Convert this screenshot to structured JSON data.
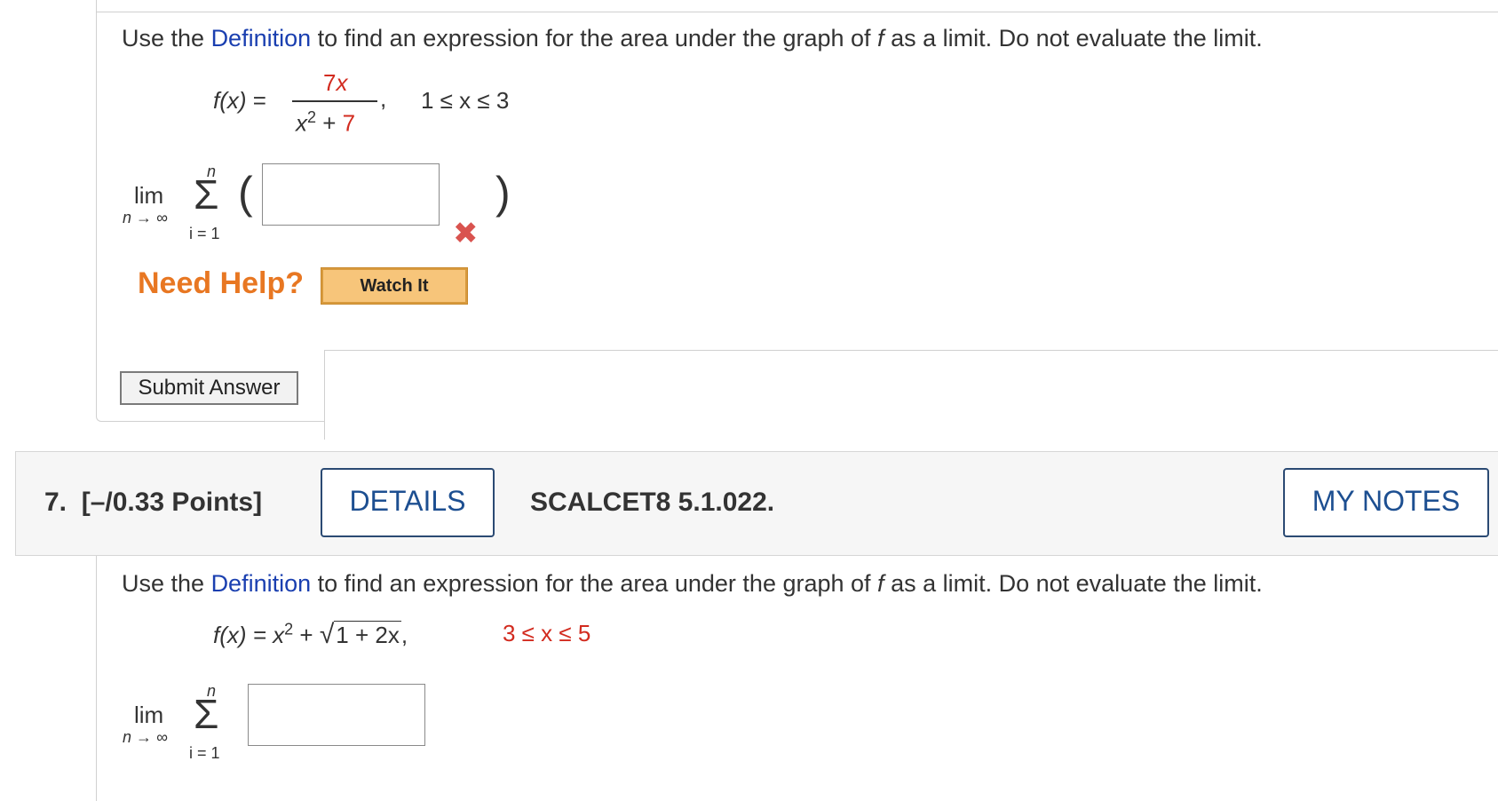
{
  "q6": {
    "prompt": {
      "before_link": "Use the ",
      "link": "Definition",
      "after_link": " to find an expression for the area under the graph of ",
      "f": "f",
      "end": " as a limit. Do not evaluate the limit."
    },
    "function": {
      "lhs": "f(x)",
      "eq": "=",
      "num_coef": "7",
      "num_var": "x",
      "den_base": "x",
      "den_exp": "2",
      "den_plus": " + ",
      "den_const": "7",
      "comma": ",",
      "domain": "1 ≤ x ≤ 3"
    },
    "limit": {
      "lim": "lim",
      "sub": "n → ∞",
      "upper": "n",
      "sigma": "Σ",
      "lower": "i = 1",
      "open_paren": "(",
      "close_paren": ")"
    },
    "answer_value": "",
    "status": "incorrect",
    "need_help": "Need Help?",
    "watch_it": "Watch It",
    "submit": "Submit Answer"
  },
  "q7": {
    "number": "7.",
    "points": "[–/0.33 Points]",
    "details_button": "DETAILS",
    "code": "SCALCET8 5.1.022.",
    "my_notes_button": "MY NOTES",
    "prompt": {
      "before_link": "Use the ",
      "link": "Definition",
      "after_link": " to find an expression for the area under the graph of ",
      "f": "f",
      "end": " as a limit. Do not evaluate the limit."
    },
    "function": {
      "lhs": "f(x) = x",
      "exp": "2",
      "plus": " + ",
      "radicand": "1 + 2x",
      "comma": ",",
      "domain": "3 ≤ x ≤ 5"
    },
    "limit": {
      "lim": "lim",
      "sub": "n → ∞",
      "upper": "n",
      "sigma": "Σ",
      "lower": "i = 1"
    },
    "answer_value": ""
  },
  "colors": {
    "link": "#1a3fb0",
    "red_value": "#d22b1f",
    "need_help": "#e87722",
    "header_button_text": "#1d4f91"
  }
}
